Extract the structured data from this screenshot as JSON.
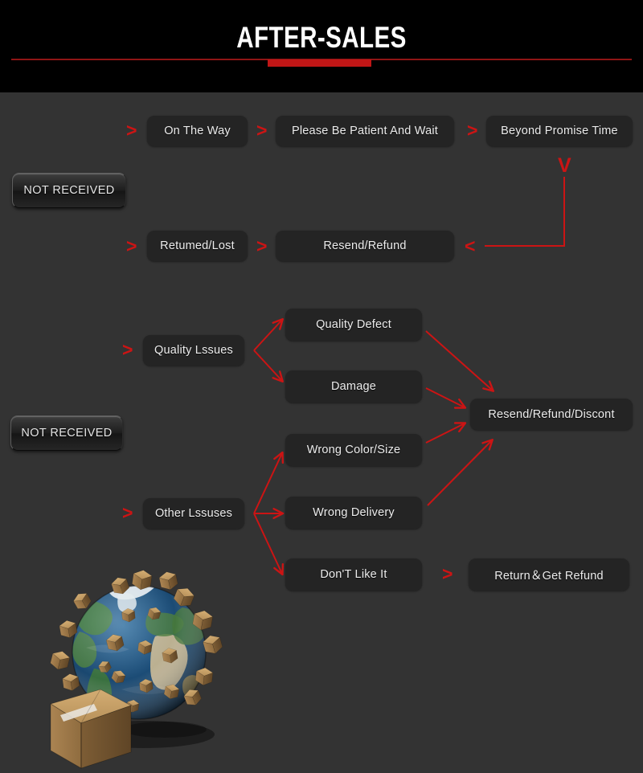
{
  "header": {
    "title": "AFTER-SALES",
    "accent_color": "#c01616",
    "rule_color": "#8f1515",
    "background": "#000000"
  },
  "page": {
    "background": "#333333",
    "node_background": "#242424",
    "node_text_color": "#ededed",
    "arrow_color": "#cc1414"
  },
  "sections": [
    {
      "name": "not-received-delivery",
      "entry_label": "NOT RECEIVED",
      "rows": [
        {
          "chain": [
            "On The Way",
            "Please Be Patient And Wait",
            "Beyond Promise Time"
          ]
        },
        {
          "chain": [
            "Retumed/Lost",
            "Resend/Refund"
          ]
        }
      ]
    },
    {
      "name": "not-received-quality",
      "entry_label": "NOT RECEIVED",
      "branches": [
        {
          "label": "Quality Lssues",
          "children": [
            "Quality Defect",
            "Damage"
          ],
          "result": "Resend/Refund/Discont"
        },
        {
          "label": "Other Lssuses",
          "children": [
            "Wrong Color/Size",
            "Wrong Delivery",
            "Don'T Like It"
          ],
          "result": "Resend/Refund/Discont",
          "alt_result": "Return＆Get Refund"
        }
      ]
    }
  ],
  "nodes": {
    "on_the_way": "On The Way",
    "please_wait": "Please Be Patient And Wait",
    "beyond_promise": "Beyond Promise Time",
    "returned_lost": "Retumed/Lost",
    "resend_refund": "Resend/Refund",
    "quality_issues": "Quality Lssues",
    "quality_defect": "Quality Defect",
    "damage": "Damage",
    "other_issues": "Other Lssuses",
    "wrong_color_size": "Wrong Color/Size",
    "wrong_delivery": "Wrong Delivery",
    "dont_like_it": "Don'T Like It",
    "resend_refund_discount": "Resend/Refund/Discont",
    "return_get_refund": "Return＆Get Refund",
    "not_received_1": "NOT RECEIVED",
    "not_received_2": "NOT RECEIVED"
  },
  "chevrons": {
    "right": ">",
    "left": "<",
    "down": "V"
  },
  "illustration": {
    "name": "globe-with-parcels",
    "description": "3D earth globe covered in cardboard shipping boxes with a large cardboard box in front"
  }
}
